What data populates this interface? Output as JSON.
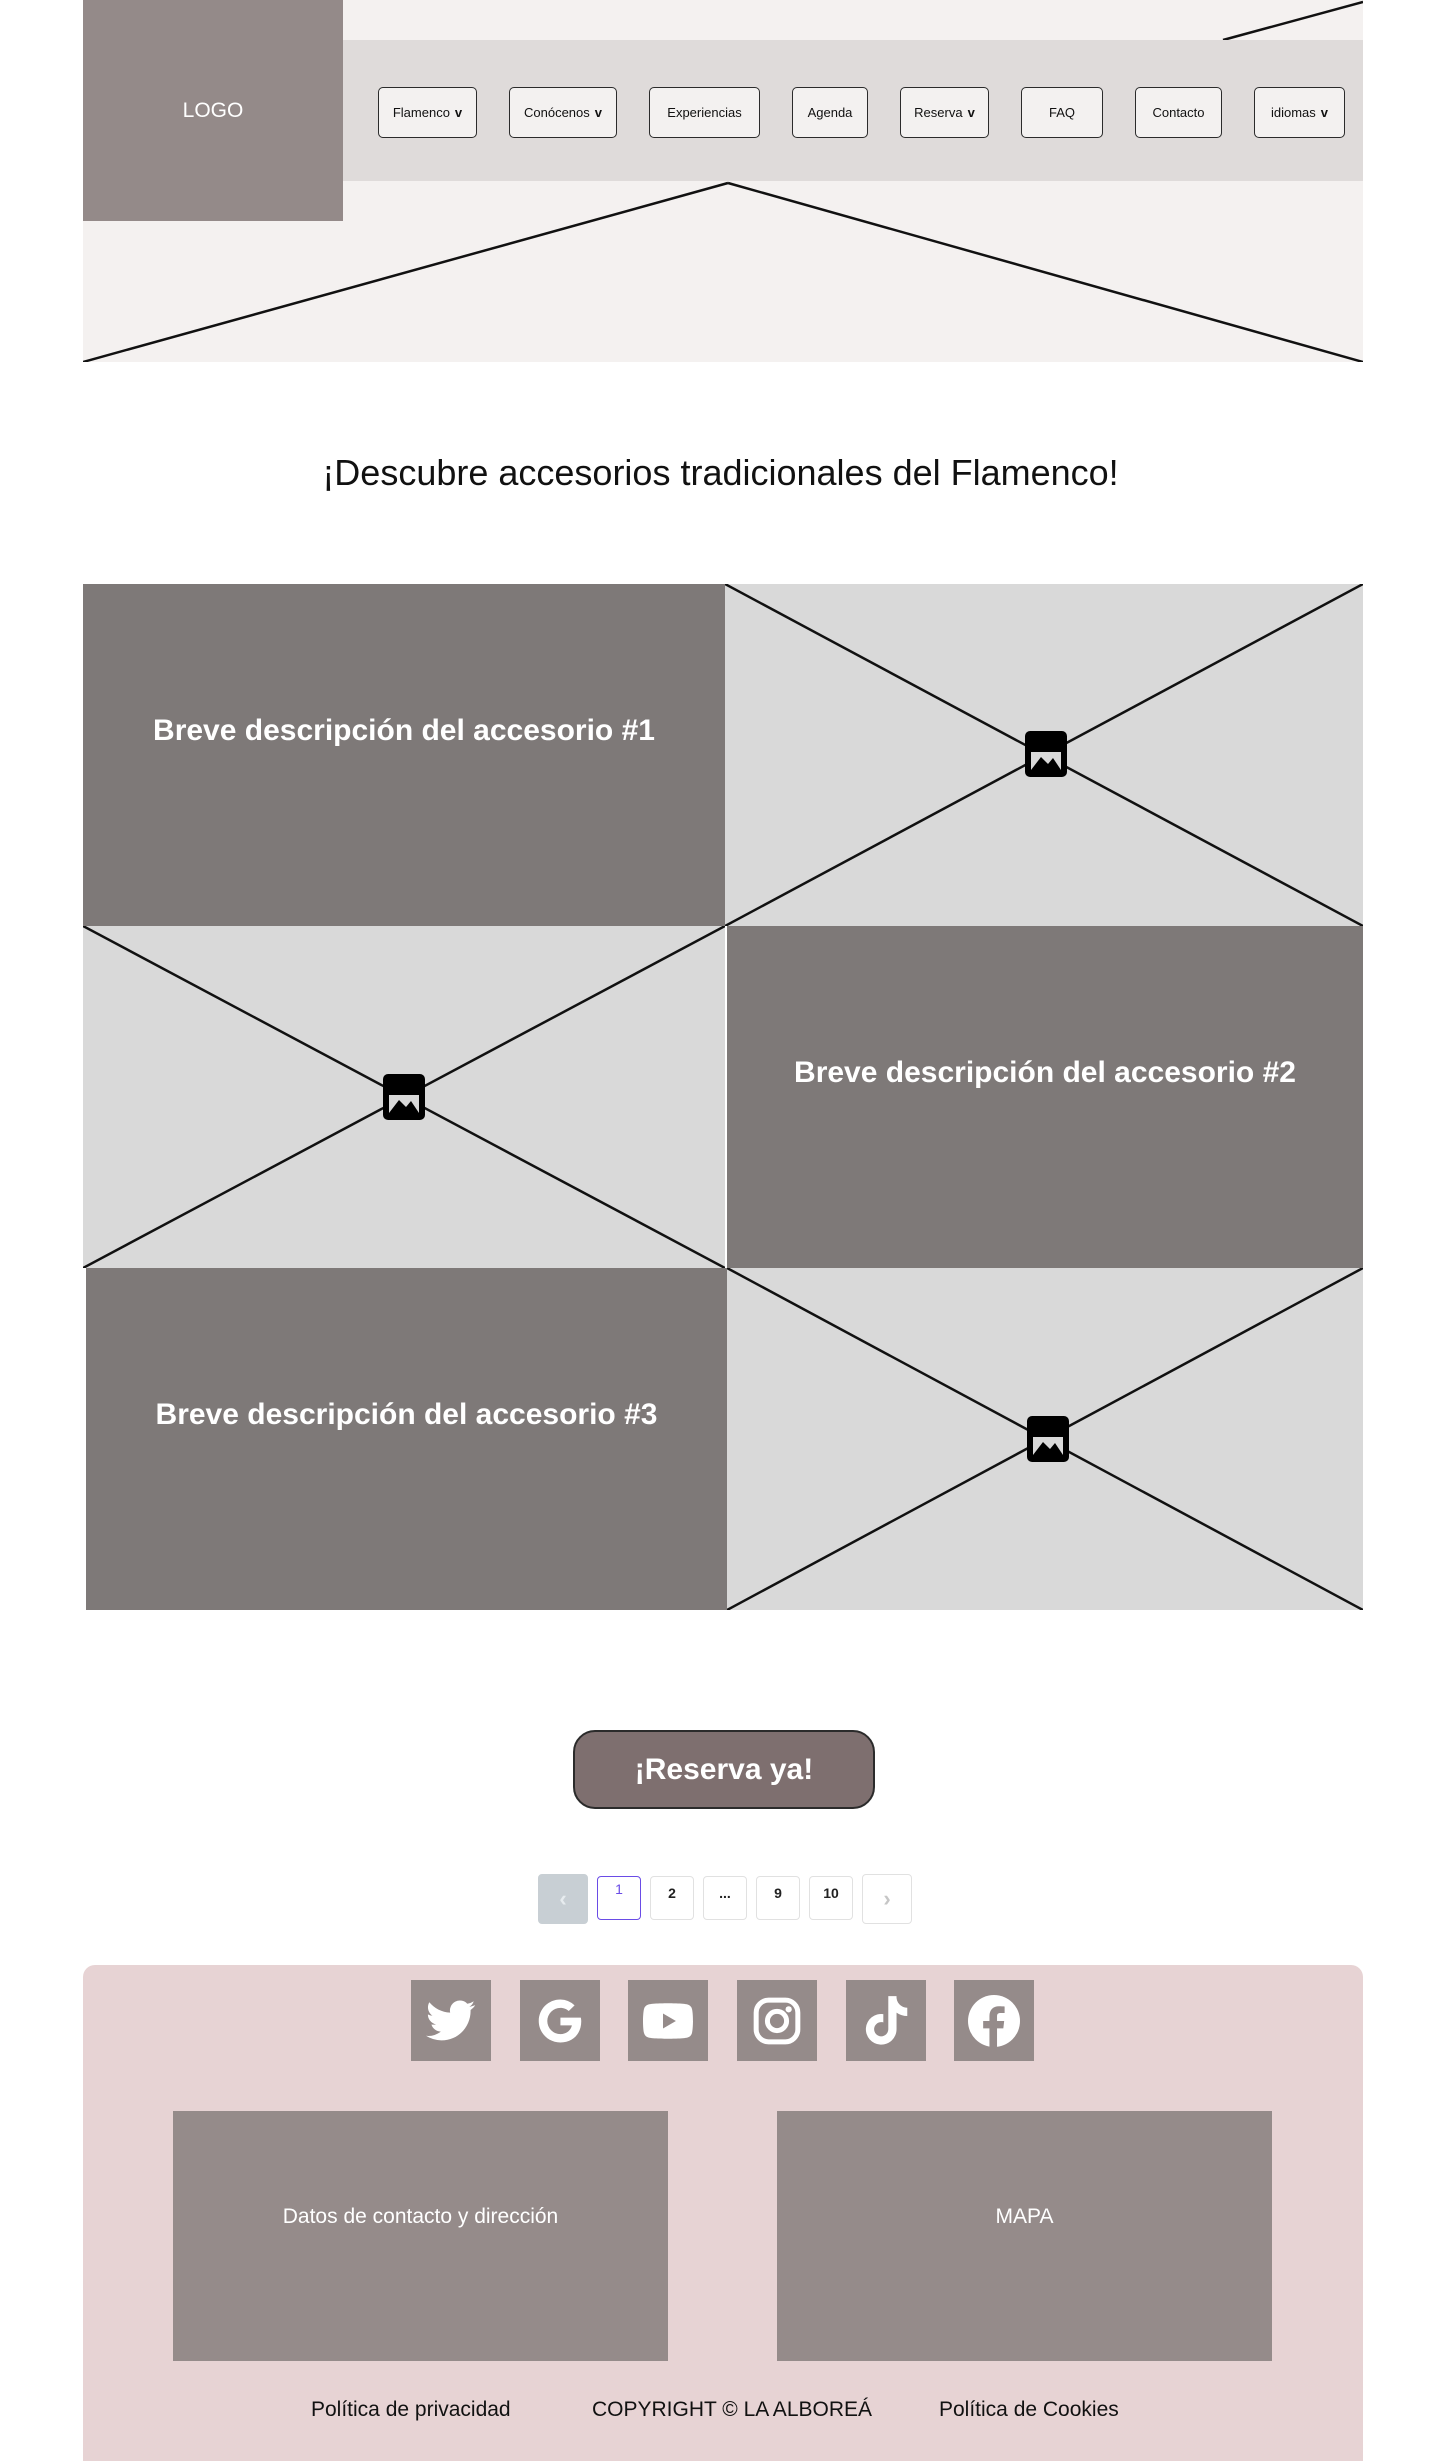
{
  "header": {
    "logo": "LOGO",
    "nav": [
      {
        "label": "Flamenco",
        "dropdown": true
      },
      {
        "label": "Conócenos",
        "dropdown": true
      },
      {
        "label": "Experiencias",
        "dropdown": false
      },
      {
        "label": "Agenda",
        "dropdown": false
      },
      {
        "label": "Reserva",
        "dropdown": true
      },
      {
        "label": "FAQ",
        "dropdown": false
      },
      {
        "label": "Contacto",
        "dropdown": false
      },
      {
        "label": "idiomas",
        "dropdown": true
      }
    ],
    "chevron": "v"
  },
  "main": {
    "title": "¡Descubre accesorios tradicionales del Flamenco!",
    "accessories": [
      {
        "description": "Breve descripción del accesorio #1"
      },
      {
        "description": "Breve descripción del accesorio #2"
      },
      {
        "description": "Breve descripción del accesorio #3"
      }
    ],
    "cta_label": "¡Reserva ya!"
  },
  "pagination": {
    "prev_icon": "‹",
    "pages": [
      "1",
      "2",
      "...",
      "9",
      "10"
    ],
    "current": "1",
    "next_icon": "›"
  },
  "footer": {
    "social_icons": [
      "twitter-icon",
      "google-icon",
      "youtube-icon",
      "instagram-icon",
      "tiktok-icon",
      "facebook-icon"
    ],
    "contact_box": "Datos de contacto y dirección",
    "map_box": "MAPA",
    "privacy": "Política de privacidad",
    "copyright": "COPYRIGHT © LA ALBOREÁ",
    "cookies": "Política de Cookies"
  },
  "colors": {
    "hero_bg": "#f4f1f0",
    "nav_bar": "#dfdbda",
    "logo_bg": "#948a89",
    "desc_tile": "#7e7978",
    "image_placeholder": "#d9d9d9",
    "cta_bg": "#7e6f6f",
    "footer_bg": "#e7d3d4",
    "social_tile": "#958b8a",
    "current_page_accent": "#6a4ce6"
  }
}
